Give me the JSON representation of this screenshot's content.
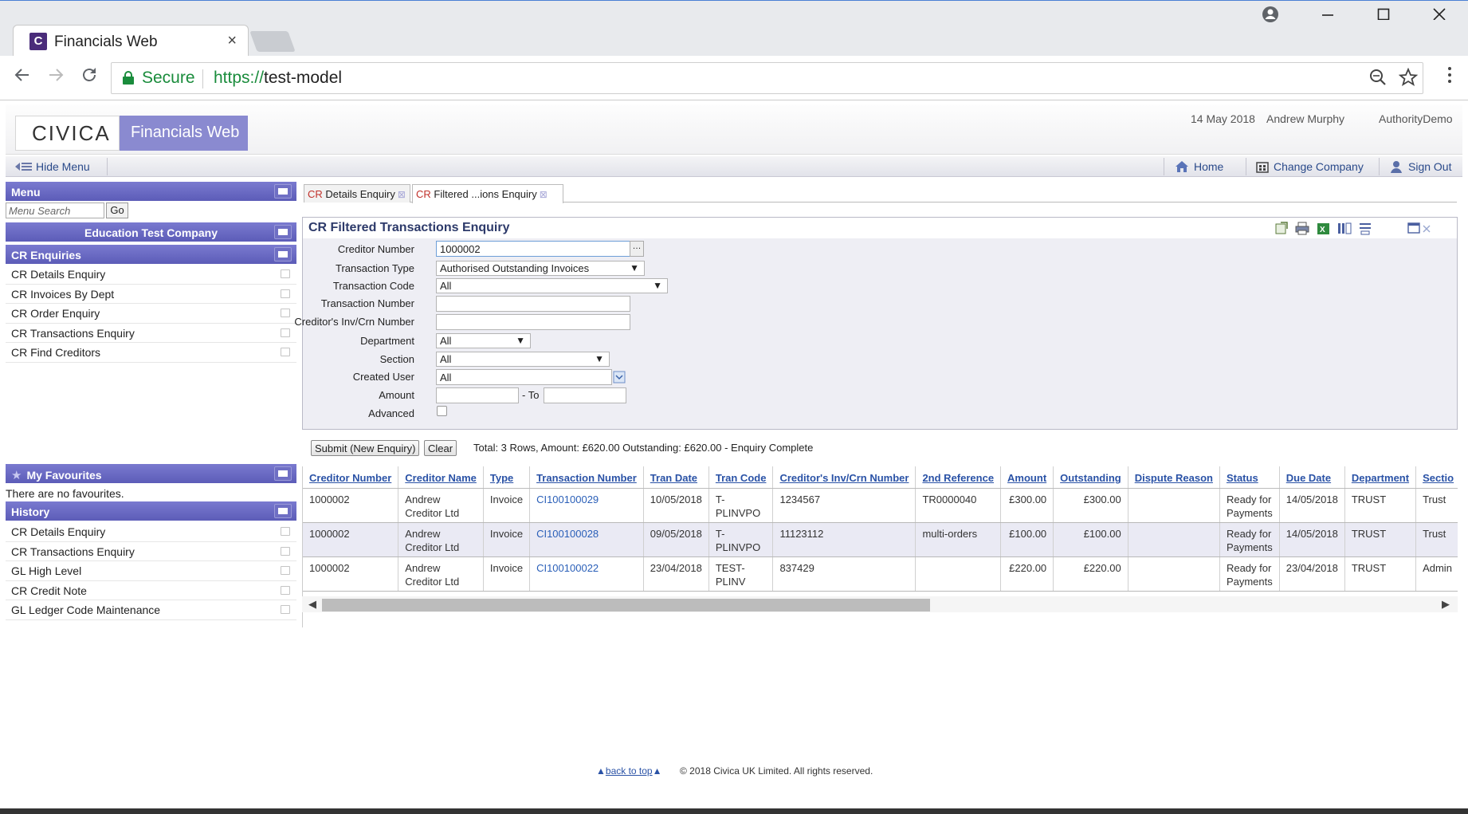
{
  "browser": {
    "tab_title": "Financials Web",
    "tab_favicon_letter": "C",
    "tab_close": "×",
    "secure_label": "Secure",
    "url_scheme": "https://",
    "url_host": "test-model"
  },
  "header": {
    "logo_text": "CIVICA",
    "product_name": "Financials Web",
    "date": "14 May 2018",
    "user": "Andrew Murphy",
    "authority": "AuthorityDemo"
  },
  "toolbar": {
    "hide_menu": "Hide Menu",
    "home": "Home",
    "change_company": "Change Company",
    "sign_out": "Sign Out"
  },
  "menu": {
    "title": "Menu",
    "search_placeholder": "Menu Search",
    "go_label": "Go",
    "company": "Education Test Company",
    "section": "CR Enquiries",
    "items": [
      "CR Details Enquiry",
      "CR Invoices By Dept",
      "CR Order Enquiry",
      "CR Transactions Enquiry",
      "CR Find Creditors"
    ],
    "favourites_title": "My Favourites",
    "favourites_empty": "There are no favourites.",
    "history_title": "History",
    "history_items": [
      "CR Details Enquiry",
      "CR Transactions Enquiry",
      "GL High Level",
      "CR Credit Note",
      "GL Ledger Code Maintenance"
    ]
  },
  "page_tabs": [
    {
      "prefix": "CR",
      "label": " Details Enquiry"
    },
    {
      "prefix": "CR",
      "label": " Filtered ...ions Enquiry"
    }
  ],
  "form": {
    "title": "CR Filtered Transactions Enquiry",
    "creditor_number_label": "Creditor Number",
    "creditor_number_value": "1000002",
    "transaction_type_label": "Transaction Type",
    "transaction_type_value": "Authorised Outstanding Invoices",
    "transaction_code_label": "Transaction Code",
    "transaction_code_value": "All",
    "transaction_number_label": "Transaction Number",
    "creditor_inv_label": "Creditor's Inv/Crn Number",
    "department_label": "Department",
    "department_value": "All",
    "section_label": "Section",
    "section_value": "All",
    "created_user_label": "Created User",
    "created_user_value": "All",
    "amount_label": "Amount",
    "amount_to_label": "- To",
    "advanced_label": "Advanced",
    "submit_label": "Submit (New Enquiry)",
    "clear_label": "Clear",
    "summary": "Total: 3 Rows, Amount: £620.00 Outstanding: £620.00 - Enquiry Complete"
  },
  "table": {
    "headers": [
      "Creditor Number",
      "Creditor Name",
      "Type",
      "Transaction Number",
      "Tran Date",
      "Tran Code",
      "Creditor's Inv/Crn Number",
      "2nd Reference",
      "Amount",
      "Outstanding",
      "Dispute Reason",
      "Status",
      "Due Date",
      "Department",
      "Sectio"
    ],
    "rows": [
      [
        "1000002",
        "Andrew Creditor Ltd",
        "Invoice",
        "CI100100029",
        "10/05/2018",
        "T-PLINVPO",
        "1234567",
        "TR0000040",
        "£300.00",
        "£300.00",
        "",
        "Ready for Payments",
        "14/05/2018",
        "TRUST",
        "Trust"
      ],
      [
        "1000002",
        "Andrew Creditor Ltd",
        "Invoice",
        "CI100100028",
        "09/05/2018",
        "T-PLINVPO",
        "11123112",
        "multi-orders",
        "£100.00",
        "£100.00",
        "",
        "Ready for Payments",
        "14/05/2018",
        "TRUST",
        "Trust"
      ],
      [
        "1000002",
        "Andrew Creditor Ltd",
        "Invoice",
        "CI100100022",
        "23/04/2018",
        "TEST-PLINV",
        "837429",
        "",
        "£220.00",
        "£220.00",
        "",
        "Ready for Payments",
        "23/04/2018",
        "TRUST",
        "Admin"
      ]
    ]
  },
  "footer": {
    "back_to_top": "back to top",
    "copyright": "© 2018 Civica UK Limited. All rights reserved."
  },
  "colors": {
    "accent_purple": "#5c5cb8",
    "brand_purple": "#8a8ad0",
    "link_blue": "#2a52a6",
    "secure_green": "#1a8c3c"
  }
}
